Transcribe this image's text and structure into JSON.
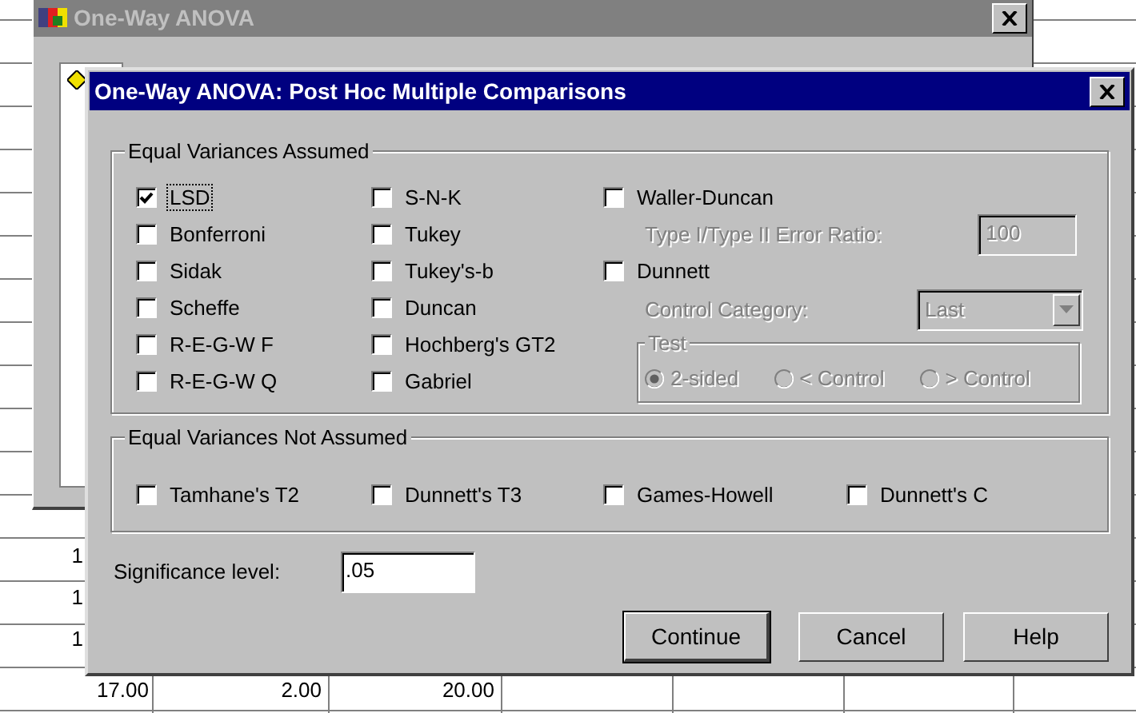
{
  "background_window": {
    "title": "One-Way ANOVA"
  },
  "sheet": {
    "left_cells": [
      "1",
      "1",
      "1"
    ],
    "bottom_row": [
      "17.00",
      "2.00",
      "20.00"
    ]
  },
  "dialog": {
    "title": "One-Way ANOVA: Post Hoc Multiple Comparisons",
    "equal_variances_assumed": {
      "label": "Equal Variances Assumed",
      "column_1": [
        {
          "label": "LSD",
          "checked": true,
          "focused": true
        },
        {
          "label": "Bonferroni",
          "checked": false,
          "focused": false
        },
        {
          "label": "Sidak",
          "checked": false,
          "focused": false
        },
        {
          "label": "Scheffe",
          "checked": false,
          "focused": false
        },
        {
          "label": "R-E-G-W F",
          "checked": false,
          "focused": false
        },
        {
          "label": "R-E-G-W Q",
          "checked": false,
          "focused": false
        }
      ],
      "column_2": [
        {
          "label": "S-N-K",
          "checked": false,
          "focused": false
        },
        {
          "label": "Tukey",
          "checked": false,
          "focused": false
        },
        {
          "label": "Tukey's-b",
          "checked": false,
          "focused": false
        },
        {
          "label": "Duncan",
          "checked": false,
          "focused": false
        },
        {
          "label": "Hochberg's GT2",
          "checked": false,
          "focused": false
        },
        {
          "label": "Gabriel",
          "checked": false,
          "focused": false
        }
      ],
      "waller_duncan": {
        "label": "Waller-Duncan",
        "checked": false
      },
      "error_ratio": {
        "label": "Type I/Type II Error Ratio:",
        "value": "100",
        "disabled": true
      },
      "dunnett": {
        "label": "Dunnett",
        "checked": false
      },
      "control_category": {
        "label": "Control Category:",
        "value": "Last",
        "disabled": true
      },
      "test": {
        "label": "Test",
        "disabled": true,
        "options": [
          {
            "label": "2-sided",
            "selected": true
          },
          {
            "label": "< Control",
            "selected": false
          },
          {
            "label": "> Control",
            "selected": false
          }
        ]
      }
    },
    "equal_variances_not_assumed": {
      "label": "Equal Variances Not Assumed",
      "items": [
        {
          "label": "Tamhane's T2",
          "checked": false
        },
        {
          "label": "Dunnett's T3",
          "checked": false
        },
        {
          "label": "Games-Howell",
          "checked": false
        },
        {
          "label": "Dunnett's C",
          "checked": false
        }
      ]
    },
    "significance": {
      "label": "Significance level:",
      "value": ".05"
    },
    "buttons": [
      {
        "label": "Continue",
        "default": true
      },
      {
        "label": "Cancel",
        "default": false
      },
      {
        "label": "Help",
        "default": false
      }
    ]
  }
}
